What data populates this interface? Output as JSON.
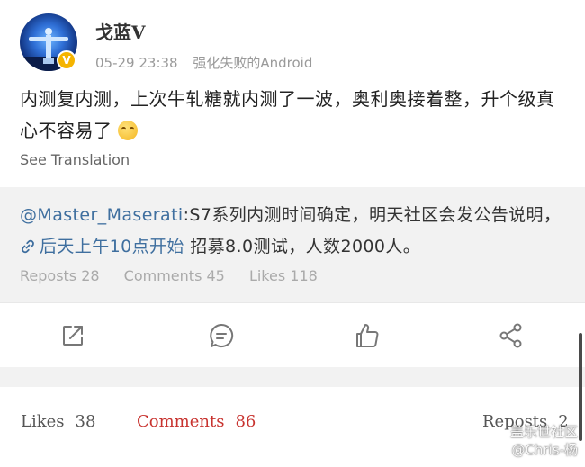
{
  "post": {
    "username": "戈蓝V",
    "timestamp": "05-29 23:38",
    "source": "强化失败的Android",
    "verified_icon": "verified-badge-icon",
    "text": "内测复内测，上次牛轧糖就内测了一波，奥利奥接着整，升个级真心不容易了",
    "emoji_icon": "laughing-crying-emoji-icon",
    "see_translation": "See Translation"
  },
  "repost": {
    "mention": "@Master_Maserati",
    "text_part1": ":S7系列内测时间确定，明天社区会发公告说明，",
    "link_label": "后天上午10点开始",
    "text_part2": "招募8.0测试，人数2000人。",
    "stats": {
      "reposts": "Reposts 28",
      "comments": "Comments 45",
      "likes": "Likes 118"
    }
  },
  "actions": [
    {
      "name": "share-out",
      "icon": "external-share-icon"
    },
    {
      "name": "comment",
      "icon": "comment-bubble-icon"
    },
    {
      "name": "like",
      "icon": "thumbs-up-icon"
    },
    {
      "name": "share",
      "icon": "share-nodes-icon"
    }
  ],
  "tabs": {
    "likes_label": "Likes",
    "likes_count": "38",
    "comments_label": "Comments",
    "comments_count": "86",
    "reposts_label": "Reposts",
    "reposts_count": "2"
  },
  "watermark": {
    "line1": "盖乐世社区",
    "line2": "@Chris-杨"
  },
  "colors": {
    "accent_red": "#c8332f",
    "link_blue": "#3f6f9f",
    "badge_gold": "#f5b400",
    "band_gray": "#f2f2f2"
  }
}
